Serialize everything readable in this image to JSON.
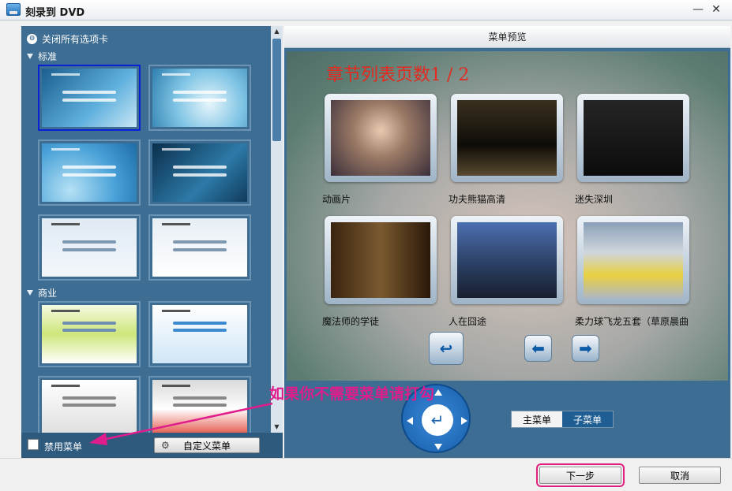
{
  "window": {
    "title": "刻录到 DVD",
    "minimize_label": "—",
    "close_label": "✕"
  },
  "left": {
    "close_all_label": "关闭所有选项卡",
    "categories": [
      {
        "label": "标准"
      },
      {
        "label": "商业"
      }
    ],
    "templates": [
      {
        "bg": "linear-gradient(135deg,#1a5e8f,#5fb0dd 60%,#c9e6f5)",
        "selected": true
      },
      {
        "bg": "radial-gradient(circle at 60% 60%,#e6f5fb,#7fc4e4 50%,#2e7fb0)",
        "selected": false
      },
      {
        "bg": "radial-gradient(circle at 30% 80%,#b5e1f5,#4aa2d8 55%,#1d6ca6)",
        "selected": false
      },
      {
        "bg": "linear-gradient(135deg,#0b2f4c,#2d7aa8 60%,#103b5c)",
        "selected": false
      },
      {
        "bg": "linear-gradient(#dfeaf4,#f3f7fb)",
        "selected": false
      },
      {
        "bg": "linear-gradient(#e6eef5,#ffffff)",
        "selected": false
      },
      {
        "bg": "linear-gradient(#f5fae0,#cde67a 50%,#ffffff)",
        "selected": false
      },
      {
        "bg": "linear-gradient(#ffffff,#cfe6f6)",
        "selected": false
      },
      {
        "bg": "linear-gradient(#ffffff,#dcdcdc)",
        "selected": false
      },
      {
        "bg": "linear-gradient(#d9d9d9,#ffffff 50%,#e04030)",
        "selected": false
      }
    ],
    "disable_menu_label": "禁用菜单",
    "custom_menu_label": "自定义菜单",
    "gear_icon": "⚙"
  },
  "preview": {
    "title": "菜单预览",
    "chapter_title": "章节列表页数1 / 2",
    "videos": [
      {
        "label": "动画片",
        "frame": "radial-gradient(circle at 50% 40%,#e9c9b0,#9b7a66 40%,#3a2e3a)"
      },
      {
        "label": "功夫熊猫高清",
        "frame": "linear-gradient(#3a3020,#0e0c08 60%,#5a4a30)"
      },
      {
        "label": "迷失深圳",
        "frame": "linear-gradient(#252525,#0c0c0c)"
      },
      {
        "label": "魔法师的学徒",
        "frame": "linear-gradient(90deg,#3a2410,#7a5a30 50%,#2a1808)"
      },
      {
        "label": "人在囧途",
        "frame": "linear-gradient(#4c6fb0,#283c5e 60%,#1a2030)"
      },
      {
        "label": "柔力球飞龙五套（草原晨曲",
        "frame": "linear-gradient(#8aa0b8,#cfd6dc 40%,#e8d040 70%,#b0b8c0)"
      }
    ],
    "return_icon": "↩",
    "prev_icon": "⬅",
    "next_icon": "➡",
    "enter_icon": "↵",
    "main_menu_label": "主菜单",
    "sub_menu_label": "子菜单"
  },
  "annotation": {
    "text": "如果你不需要菜单请打勾",
    "color": "#e01d8c"
  },
  "footer": {
    "next_label": "下一步",
    "cancel_label": "取消"
  }
}
